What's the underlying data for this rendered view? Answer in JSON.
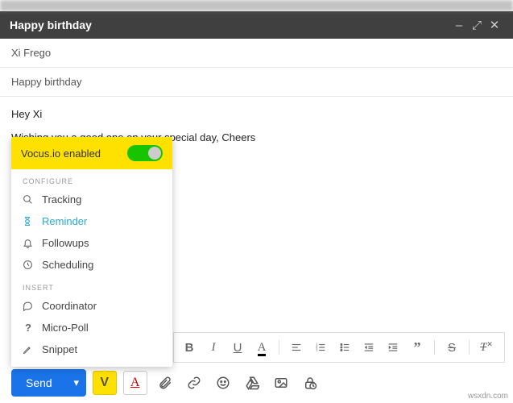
{
  "window": {
    "title": "Happy birthday"
  },
  "fields": {
    "to": "Xi Frego",
    "subject": "Happy birthday"
  },
  "body": {
    "greeting": "Hey Xi",
    "line1": "Wishing you a good one on your special day, Cheers"
  },
  "vocus": {
    "header": "Vocus.io enabled",
    "toggle_on": true,
    "section_configure": "CONFIGURE",
    "section_insert": "INSERT",
    "items_configure": [
      {
        "icon": "search-icon",
        "label": "Tracking",
        "selected": false
      },
      {
        "icon": "hourglass-icon",
        "label": "Reminder",
        "selected": true
      },
      {
        "icon": "bell-icon",
        "label": "Followups",
        "selected": false
      },
      {
        "icon": "clock-icon",
        "label": "Scheduling",
        "selected": false
      }
    ],
    "items_insert": [
      {
        "icon": "chat-icon",
        "label": "Coordinator"
      },
      {
        "icon": "question-icon",
        "label": "Micro-Poll"
      },
      {
        "icon": "pencil-icon",
        "label": "Snippet"
      }
    ]
  },
  "format_toolbar": {
    "bold": "B",
    "italic": "I",
    "underline": "U",
    "textcolor": "A"
  },
  "bottom": {
    "send": "Send",
    "vocus_letter": "V",
    "font_letter": "A"
  },
  "watermark": "wsxdn.com"
}
